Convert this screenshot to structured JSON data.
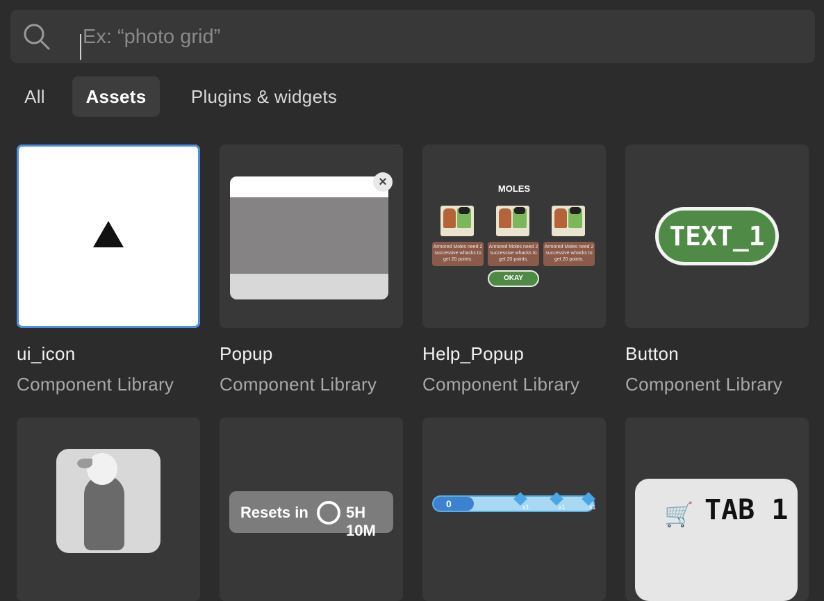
{
  "search": {
    "placeholder": "Ex: “photo grid”",
    "value": ""
  },
  "tabs": [
    {
      "label": "All",
      "active": false
    },
    {
      "label": "Assets",
      "active": true
    },
    {
      "label": "Plugins & widgets",
      "active": false
    }
  ],
  "cards": [
    {
      "title": "ui_icon",
      "subtitle": "Component Library",
      "selected": true
    },
    {
      "title": "Popup",
      "subtitle": "Component Library"
    },
    {
      "title": "Help_Popup",
      "subtitle": "Component Library",
      "preview": {
        "heading": "MOLES",
        "note": "Armored Moles need 2 successive whacks to get 20 points.",
        "button": "OKAY"
      }
    },
    {
      "title": "Button",
      "subtitle": "Component Library",
      "preview": {
        "label": "TEXT_1"
      }
    },
    {
      "title": "",
      "subtitle": ""
    },
    {
      "title": "",
      "subtitle": "",
      "preview": {
        "left": "Resets in",
        "right": "5H 10M"
      }
    },
    {
      "title": "",
      "subtitle": "",
      "preview": {
        "start": "0",
        "multiplier": "x1"
      }
    },
    {
      "title": "",
      "subtitle": "",
      "preview": {
        "label": "TAB 1"
      }
    }
  ],
  "colors": {
    "background": "#2c2c2c",
    "card": "#383838",
    "accent": "#4a8fe0"
  }
}
